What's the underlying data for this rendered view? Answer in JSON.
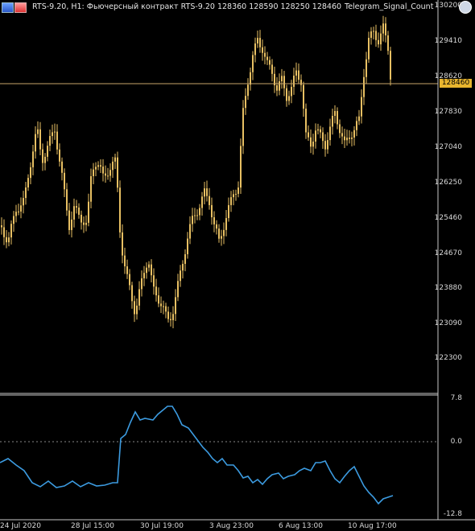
{
  "header": {
    "symbol_line": "RTS-9.20, H1:  Фьючерсный контракт RTS-9.20  128360 128590 128250 128460",
    "indicator_name": "Telegram_Signal_Count"
  },
  "price_axis": {
    "labels": [
      "130200",
      "129410",
      "128620",
      "127830",
      "127040",
      "126250",
      "125460",
      "124670",
      "123880",
      "123090",
      "122300"
    ],
    "current_price": "128460"
  },
  "indicator_axis": {
    "labels": [
      "7.8",
      "0.0",
      "-12.8"
    ]
  },
  "time_axis": {
    "labels": [
      "24 Jul 2020",
      "28 Jul 15:00",
      "30 Jul 19:00",
      "3 Aug 23:00",
      "6 Aug 13:00",
      "10 Aug 17:00"
    ]
  },
  "colors": {
    "candle": "#e8c063",
    "price_line": "#c9a46a",
    "indicator_line": "#3c9be0",
    "grid": "#c8c8c8"
  }
}
